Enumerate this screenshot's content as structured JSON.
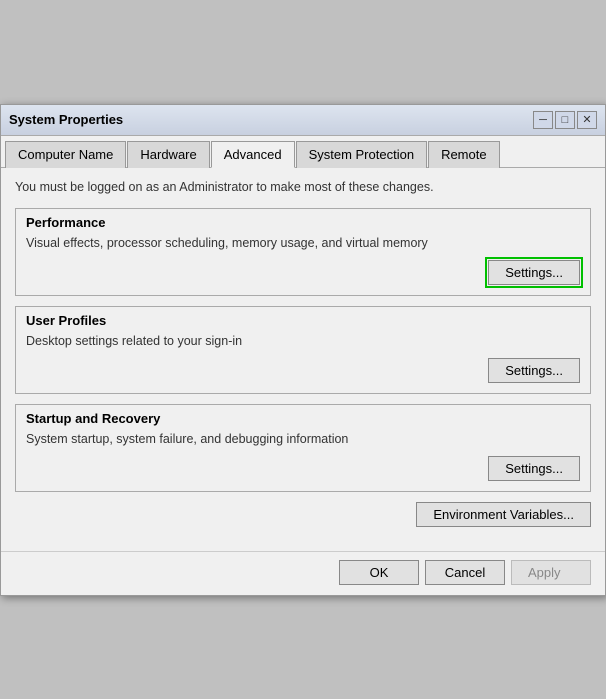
{
  "window": {
    "title": "System Properties"
  },
  "tabs": [
    {
      "label": "Computer Name",
      "active": false
    },
    {
      "label": "Hardware",
      "active": false
    },
    {
      "label": "Advanced",
      "active": true
    },
    {
      "label": "System Protection",
      "active": false
    },
    {
      "label": "Remote",
      "active": false
    }
  ],
  "admin_notice": "You must be logged on as an Administrator to make most of these changes.",
  "performance": {
    "title": "Performance",
    "description": "Visual effects, processor scheduling, memory usage, and virtual memory",
    "settings_label": "Settings..."
  },
  "user_profiles": {
    "title": "User Profiles",
    "description": "Desktop settings related to your sign-in",
    "settings_label": "Settings..."
  },
  "startup_recovery": {
    "title": "Startup and Recovery",
    "description": "System startup, system failure, and debugging information",
    "settings_label": "Settings..."
  },
  "env_button_label": "Environment Variables...",
  "bottom": {
    "ok_label": "OK",
    "cancel_label": "Cancel",
    "apply_label": "Apply"
  },
  "icons": {
    "close": "✕",
    "minimize": "─",
    "maximize": "□"
  }
}
